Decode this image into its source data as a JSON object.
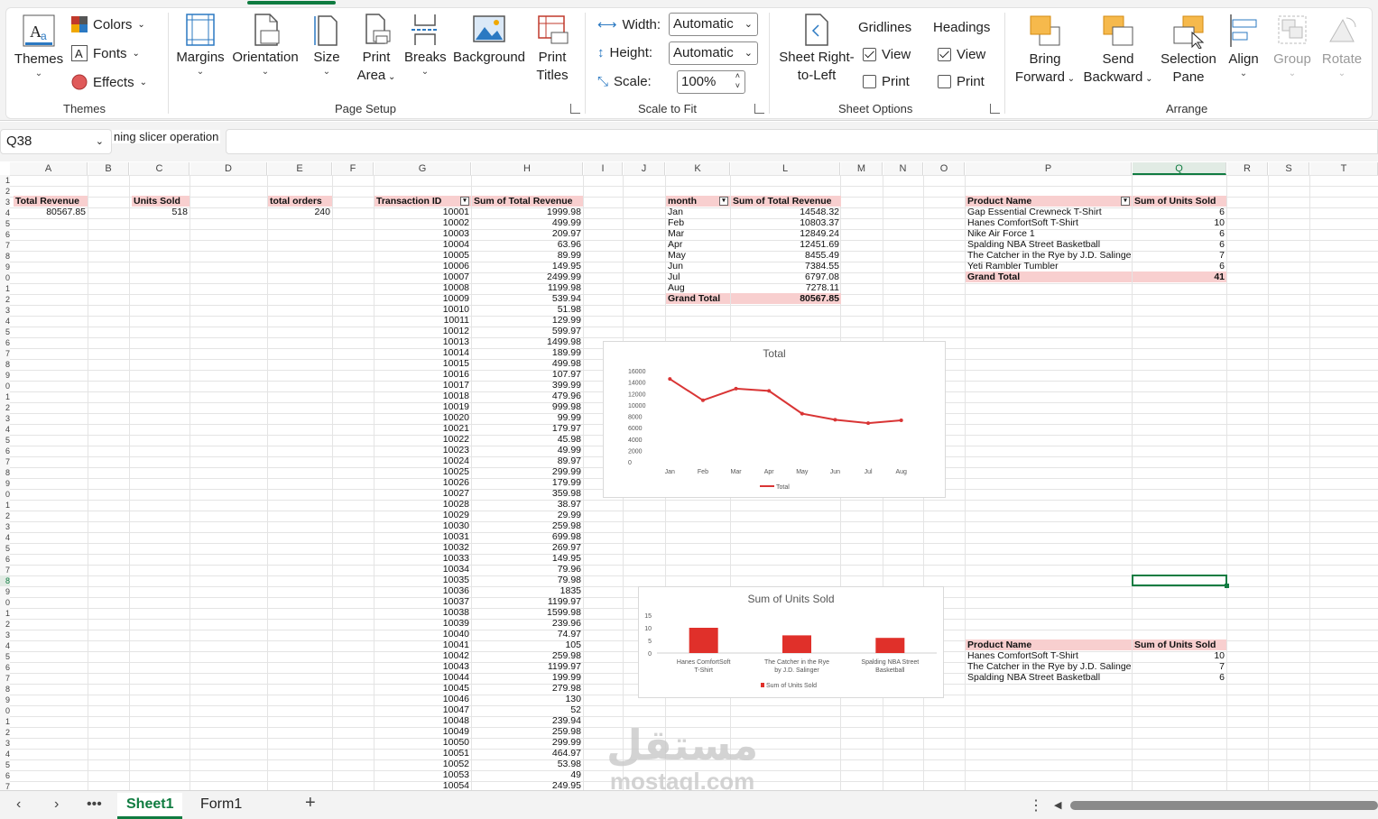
{
  "ribbon": {
    "groups": {
      "themes": "Themes",
      "page_setup": "Page Setup",
      "scale_to_fit": "Scale to Fit",
      "sheet_options": "Sheet Options",
      "arrange": "Arrange"
    },
    "themes_btn": "Themes",
    "colors": "Colors",
    "fonts": "Fonts",
    "effects": "Effects",
    "margins": "Margins",
    "orientation": "Orientation",
    "size": "Size",
    "print_area_1": "Print",
    "print_area_2": "Area",
    "breaks": "Breaks",
    "background": "Background",
    "print_titles_1": "Print",
    "print_titles_2": "Titles",
    "width_label": "Width:",
    "width_value": "Automatic",
    "height_label": "Height:",
    "height_value": "Automatic",
    "scale_label": "Scale:",
    "scale_value": "100%",
    "sheet_rtl_1": "Sheet Right-",
    "sheet_rtl_2": "to-Left",
    "gridlines": "Gridlines",
    "headings": "Headings",
    "view": "View",
    "print": "Print",
    "bring_forward_1": "Bring",
    "bring_forward_2": "Forward",
    "send_backward_1": "Send",
    "send_backward_2": "Backward",
    "selection_pane_1": "Selection",
    "selection_pane_2": "Pane",
    "align": "Align",
    "group": "Group",
    "rotate": "Rotate"
  },
  "formula_bar": {
    "name_box": "Q38",
    "tooltip": "ning slicer operation"
  },
  "columns": [
    "A",
    "B",
    "C",
    "D",
    "E",
    "F",
    "G",
    "H",
    "I",
    "J",
    "K",
    "L",
    "M",
    "N",
    "O",
    "P",
    "Q",
    "R",
    "S",
    "T"
  ],
  "rows": [
    "1",
    "2",
    "3",
    "4",
    "5",
    "6",
    "7",
    "8",
    "9",
    "0",
    "1",
    "2",
    "3",
    "4",
    "5",
    "6",
    "7",
    "8",
    "9",
    "0",
    "1",
    "2",
    "3",
    "4",
    "5",
    "6",
    "7",
    "8",
    "9",
    "0",
    "1",
    "2",
    "3",
    "4",
    "5",
    "6",
    "7",
    "8",
    "9",
    "0",
    "1",
    "2",
    "3",
    "4",
    "5",
    "6",
    "7",
    "8",
    "9",
    "0",
    "1",
    "2",
    "3",
    "4",
    "5",
    "6",
    "7"
  ],
  "kpis": {
    "total_revenue_label": "Total Revenue",
    "total_revenue_value": "80567.85",
    "units_sold_label": "Units Sold",
    "units_sold_value": "518",
    "total_orders_label": "total orders",
    "total_orders_value": "240"
  },
  "transactions": {
    "header_id": "Transaction ID",
    "header_sum": "Sum of Total Revenue",
    "rows": [
      [
        "10001",
        "1999.98"
      ],
      [
        "10002",
        "499.99"
      ],
      [
        "10003",
        "209.97"
      ],
      [
        "10004",
        "63.96"
      ],
      [
        "10005",
        "89.99"
      ],
      [
        "10006",
        "149.95"
      ],
      [
        "10007",
        "2499.99"
      ],
      [
        "10008",
        "1199.98"
      ],
      [
        "10009",
        "539.94"
      ],
      [
        "10010",
        "51.98"
      ],
      [
        "10011",
        "129.99"
      ],
      [
        "10012",
        "599.97"
      ],
      [
        "10013",
        "1499.98"
      ],
      [
        "10014",
        "189.99"
      ],
      [
        "10015",
        "499.98"
      ],
      [
        "10016",
        "107.97"
      ],
      [
        "10017",
        "399.99"
      ],
      [
        "10018",
        "479.96"
      ],
      [
        "10019",
        "999.98"
      ],
      [
        "10020",
        "99.99"
      ],
      [
        "10021",
        "179.97"
      ],
      [
        "10022",
        "45.98"
      ],
      [
        "10023",
        "49.99"
      ],
      [
        "10024",
        "89.97"
      ],
      [
        "10025",
        "299.99"
      ],
      [
        "10026",
        "179.99"
      ],
      [
        "10027",
        "359.98"
      ],
      [
        "10028",
        "38.97"
      ],
      [
        "10029",
        "29.99"
      ],
      [
        "10030",
        "259.98"
      ],
      [
        "10031",
        "699.98"
      ],
      [
        "10032",
        "269.97"
      ],
      [
        "10033",
        "149.95"
      ],
      [
        "10034",
        "79.96"
      ],
      [
        "10035",
        "79.98"
      ],
      [
        "10036",
        "1835"
      ],
      [
        "10037",
        "1199.97"
      ],
      [
        "10038",
        "1599.98"
      ],
      [
        "10039",
        "239.96"
      ],
      [
        "10040",
        "74.97"
      ],
      [
        "10041",
        "105"
      ],
      [
        "10042",
        "259.98"
      ],
      [
        "10043",
        "1199.97"
      ],
      [
        "10044",
        "199.99"
      ],
      [
        "10045",
        "279.98"
      ],
      [
        "10046",
        "130"
      ],
      [
        "10047",
        "52"
      ],
      [
        "10048",
        "239.94"
      ],
      [
        "10049",
        "259.98"
      ],
      [
        "10050",
        "299.99"
      ],
      [
        "10051",
        "464.97"
      ],
      [
        "10052",
        "53.98"
      ],
      [
        "10053",
        "49"
      ],
      [
        "10054",
        "249.95"
      ]
    ]
  },
  "monthly": {
    "header_month": "month",
    "header_sum": "Sum of Total Revenue",
    "rows": [
      [
        "Jan",
        "14548.32"
      ],
      [
        "Feb",
        "10803.37"
      ],
      [
        "Mar",
        "12849.24"
      ],
      [
        "Apr",
        "12451.69"
      ],
      [
        "May",
        "8455.49"
      ],
      [
        "Jun",
        "7384.55"
      ],
      [
        "Jul",
        "6797.08"
      ],
      [
        "Aug",
        "7278.11"
      ]
    ],
    "grand_total_label": "Grand Total",
    "grand_total_value": "80567.85"
  },
  "products": {
    "header_name": "Product Name",
    "header_sum": "Sum of Units Sold",
    "rows": [
      [
        "Gap Essential Crewneck T-Shirt",
        "6"
      ],
      [
        "Hanes ComfortSoft T-Shirt",
        "10"
      ],
      [
        "Nike Air Force 1",
        "6"
      ],
      [
        "Spalding NBA Street Basketball",
        "6"
      ],
      [
        "The Catcher in the Rye by J.D. Salinger",
        "7"
      ],
      [
        "Yeti Rambler Tumbler",
        "6"
      ]
    ],
    "grand_total_label": "Grand Total",
    "grand_total_value": "41"
  },
  "top_products": {
    "header_name": "Product Name",
    "header_sum": "Sum of Units Sold",
    "rows": [
      [
        "Hanes ComfortSoft T-Shirt",
        "10"
      ],
      [
        "The Catcher in the Rye by J.D. Salinger",
        "7"
      ],
      [
        "Spalding NBA Street Basketball",
        "6"
      ]
    ]
  },
  "chart_data": [
    {
      "type": "line",
      "title": "Total",
      "categories": [
        "Jan",
        "Feb",
        "Mar",
        "Apr",
        "May",
        "Jun",
        "Jul",
        "Aug"
      ],
      "series": [
        {
          "name": "Total",
          "values": [
            14548.32,
            10803.37,
            12849.24,
            12451.69,
            8455.49,
            7384.55,
            6797.08,
            7278.11
          ]
        }
      ],
      "yticks": [
        "16000",
        "14000",
        "12000",
        "10000",
        "8000",
        "6000",
        "4000",
        "2000",
        "0"
      ],
      "ylim": [
        0,
        16000
      ],
      "color": "#d93535",
      "legend": "bottom"
    },
    {
      "type": "bar",
      "title": "Sum of Units Sold",
      "categories": [
        "Hanes ComfortSoft T-Shirt",
        "The Catcher in the Rye by J.D. Salinger",
        "Spalding NBA Street Basketball"
      ],
      "series": [
        {
          "name": "Sum of Units Sold",
          "values": [
            10,
            7,
            6
          ]
        }
      ],
      "yticks": [
        "15",
        "10",
        "5",
        "0"
      ],
      "ylim": [
        0,
        15
      ],
      "color": "#e0302a",
      "legend": "bottom"
    }
  ],
  "sheets": [
    "Sheet1",
    "Form1"
  ],
  "active_sheet": "Sheet1",
  "watermark": {
    "arabic": "مستقل",
    "latin": "mostaql.com"
  }
}
